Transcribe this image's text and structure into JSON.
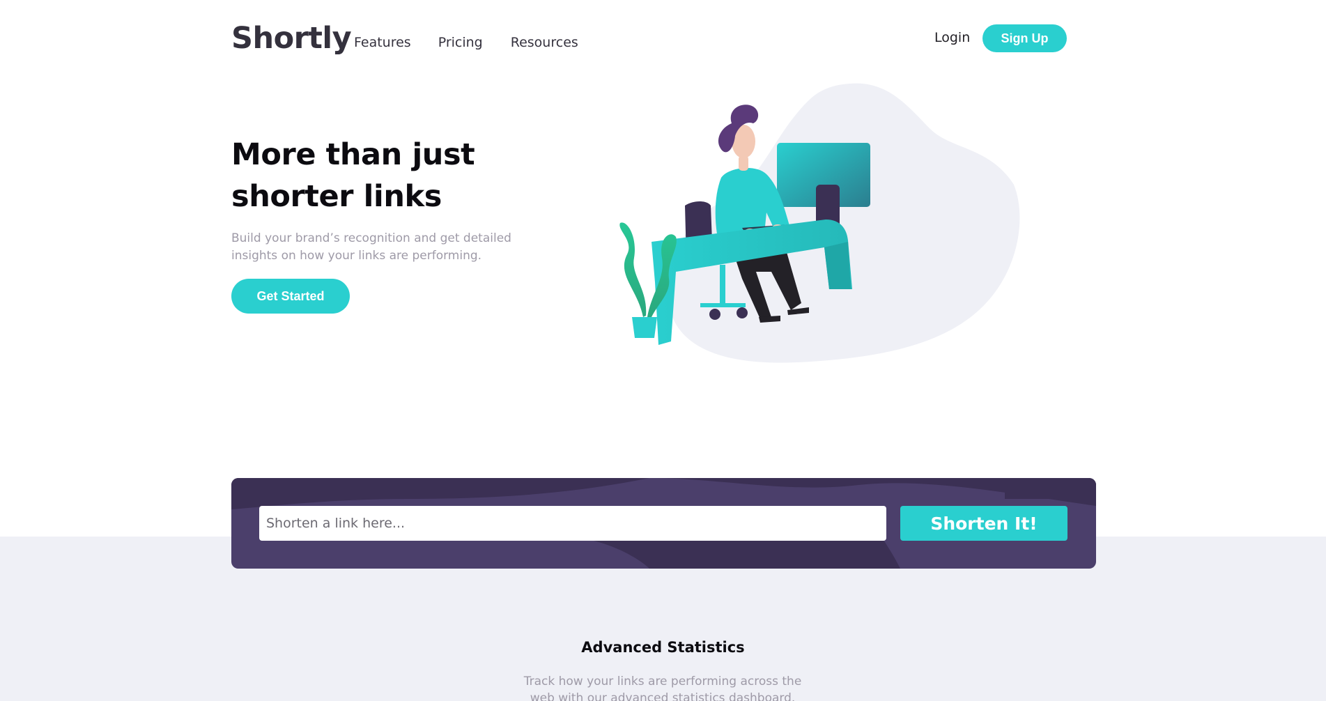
{
  "header": {
    "logo": "Shortly",
    "nav": [
      "Features",
      "Pricing",
      "Resources"
    ],
    "login_label": "Login",
    "signup_label": "Sign Up"
  },
  "hero": {
    "title_line1": "More than just",
    "title_line2": "shorter links",
    "description": "Build your brand’s recognition and get detailed insights on how your links are performing.",
    "cta_label": "Get Started"
  },
  "shorten": {
    "placeholder": "Shorten a link here...",
    "button_label": "Shorten It!"
  },
  "stats": {
    "title": "Advanced Statistics",
    "description": "Track how your links are performing across the web with our advanced statistics dashboard."
  },
  "colors": {
    "accent": "#2acfcf",
    "dark_violet": "#3b3054",
    "box_violet": "#4b3f6b",
    "gray_band": "#eff0f6",
    "text_gray": "#9e9aa7"
  }
}
